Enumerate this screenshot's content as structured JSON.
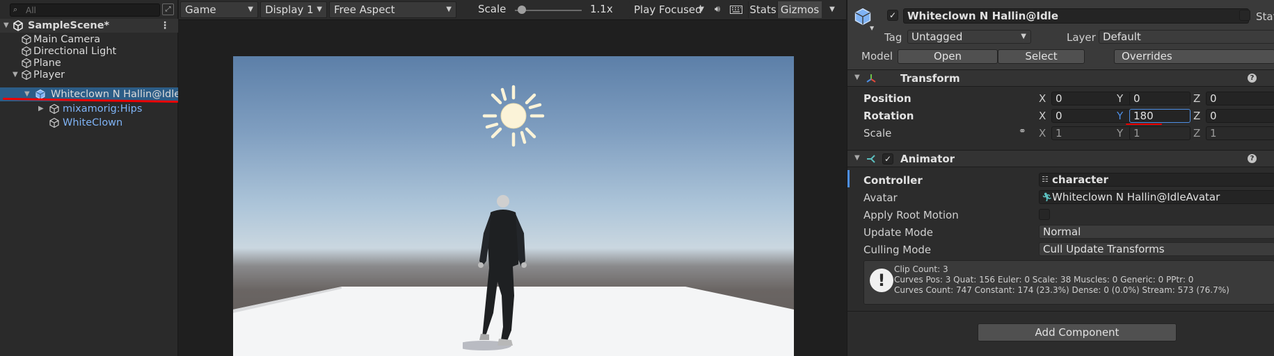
{
  "hierarchy": {
    "search_placeholder": "All",
    "items": [
      {
        "label": "SampleScene*"
      },
      {
        "label": "Main Camera"
      },
      {
        "label": "Directional Light"
      },
      {
        "label": "Plane"
      },
      {
        "label": "Player"
      },
      {
        "label": "Whiteclown N Hallin@Idle"
      },
      {
        "label": "mixamorig:Hips"
      },
      {
        "label": "WhiteClown"
      }
    ]
  },
  "game_toolbar": {
    "view": "Game",
    "display": "Display 1",
    "aspect": "Free Aspect",
    "scale_label": "Scale",
    "scale_value": "1.1x",
    "scale_slider_fraction": 0.1,
    "play_mode": "Play Focused",
    "stats": "Stats",
    "gizmos": "Gizmos"
  },
  "inspector": {
    "object_name": "Whiteclown N Hallin@Idle",
    "static_label": "Stat",
    "tag_label": "Tag",
    "tag_value": "Untagged",
    "layer_label": "Layer",
    "layer_value": "Default",
    "model_label": "Model",
    "open_button": "Open",
    "select_button": "Select",
    "overrides_button": "Overrides",
    "transform": {
      "title": "Transform",
      "position_label": "Position",
      "rotation_label": "Rotation",
      "scale_label": "Scale",
      "x_axis": "X",
      "y_axis": "Y",
      "z_axis": "Z",
      "position": {
        "x": "0",
        "y": "0",
        "z": "0"
      },
      "rotation": {
        "x": "0",
        "y": "180",
        "z": "0"
      },
      "scale": {
        "x": "1",
        "y": "1",
        "z": "1"
      }
    },
    "animator": {
      "title": "Animator",
      "controller_label": "Controller",
      "controller_value": "character",
      "avatar_label": "Avatar",
      "avatar_value": "Whiteclown N Hallin@IdleAvatar",
      "apply_root_motion_label": "Apply Root Motion",
      "update_mode_label": "Update Mode",
      "update_mode_value": "Normal",
      "culling_mode_label": "Culling Mode",
      "culling_mode_value": "Cull Update Transforms",
      "info_line1": "Clip Count: 3",
      "info_line2": "Curves Pos: 3 Quat: 156 Euler: 0 Scale: 38 Muscles: 0 Generic: 0 PPtr: 0",
      "info_line3": "Curves Count: 747 Constant: 174 (23.3%) Dense: 0 (0.0%) Stream: 573 (76.7%)"
    },
    "add_component": "Add Component"
  }
}
